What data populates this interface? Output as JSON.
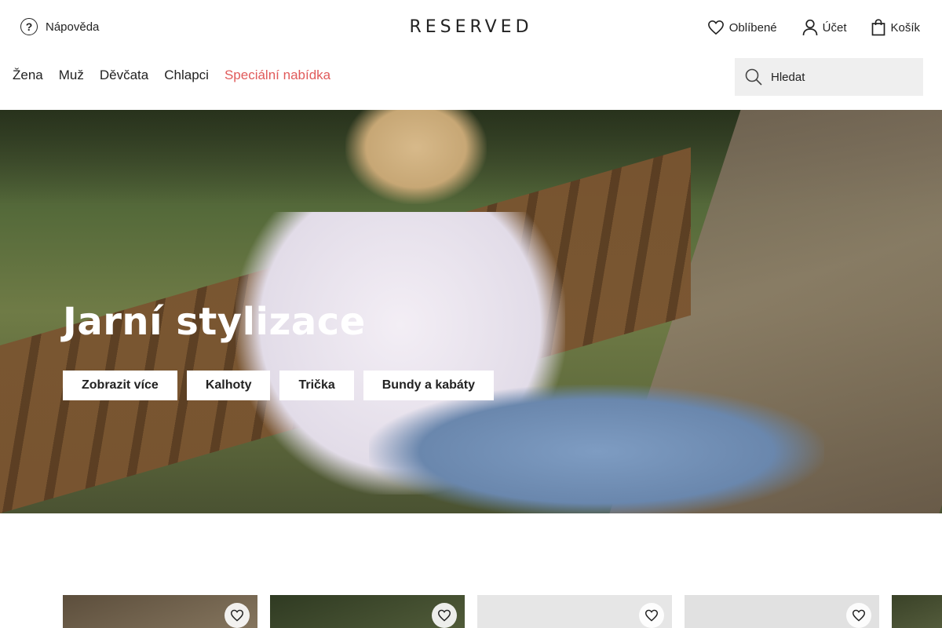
{
  "header": {
    "help_label": "Nápověda",
    "logo": "RESERVED",
    "favorites_label": "Oblíbené",
    "account_label": "Účet",
    "cart_label": "Košík"
  },
  "nav": {
    "items": [
      {
        "label": "Žena"
      },
      {
        "label": "Muž"
      },
      {
        "label": "Děvčata"
      },
      {
        "label": "Chlapci"
      },
      {
        "label": "Speciální nabídka"
      }
    ],
    "special_color": "#e05a5a"
  },
  "search": {
    "placeholder": "Hledat"
  },
  "hero": {
    "title": "Jarní stylizace",
    "buttons": [
      {
        "label": "Zobrazit více"
      },
      {
        "label": "Kalhoty"
      },
      {
        "label": "Trička"
      },
      {
        "label": "Bundy a kabáty"
      }
    ]
  },
  "products": [
    {
      "image_color": "#6b5a45",
      "fav_icon": "heart-icon"
    },
    {
      "image_color": "#3e4a2c",
      "fav_icon": "heart-icon"
    },
    {
      "image_color": "#e6e6e6",
      "fav_icon": "heart-icon"
    },
    {
      "image_color": "#e1e1e1",
      "fav_icon": "heart-icon"
    },
    {
      "image_color": "#4c5436",
      "fav_icon": ""
    }
  ]
}
